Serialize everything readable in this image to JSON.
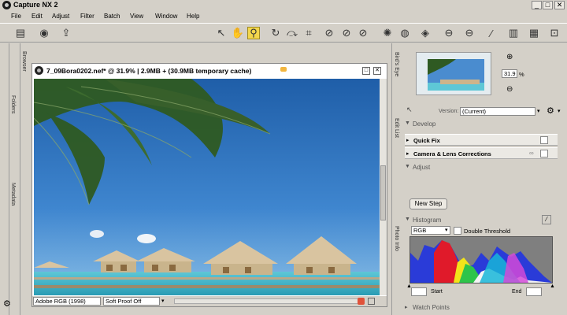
{
  "app": {
    "title": "Capture NX 2"
  },
  "window_controls": {
    "minimize": "_",
    "maximize": "□",
    "close": "✕"
  },
  "menu": [
    "File",
    "Edit",
    "Adjust",
    "Filter",
    "Batch",
    "View",
    "Window",
    "Help"
  ],
  "left_tabs": {
    "folders": "Folders",
    "browser": "Browser",
    "metadata": "Metadata"
  },
  "image_window": {
    "title": "7_09Bora0202.nef* @ 31.9% | 2.9MB + (30.9MB temporary cache)",
    "color_profile": "Adobe RGB (1998)",
    "soft_proof": "Soft Proof Off"
  },
  "birds_eye": {
    "tab": "Bird's Eye",
    "zoom": "31.9",
    "zoom_unit": "%"
  },
  "edit_list": {
    "tab": "Edit List",
    "version_label": "Version:",
    "version_value": "(Current)",
    "develop": "Develop",
    "quick_fix": "Quick Fix",
    "camera_lens": "Camera & Lens Corrections",
    "adjust": "Adjust",
    "new_step": "New Step"
  },
  "photo_info": {
    "tab": "Photo Info",
    "histogram": "Histogram",
    "channel": "RGB",
    "double_threshold": "Double Threshold",
    "start_label": "Start",
    "end_label": "End",
    "watch_points": "Watch Points"
  },
  "colors": {
    "accent": "#f2d64c",
    "sky": "#2f6fb8",
    "sea": "#3fb4c8"
  }
}
